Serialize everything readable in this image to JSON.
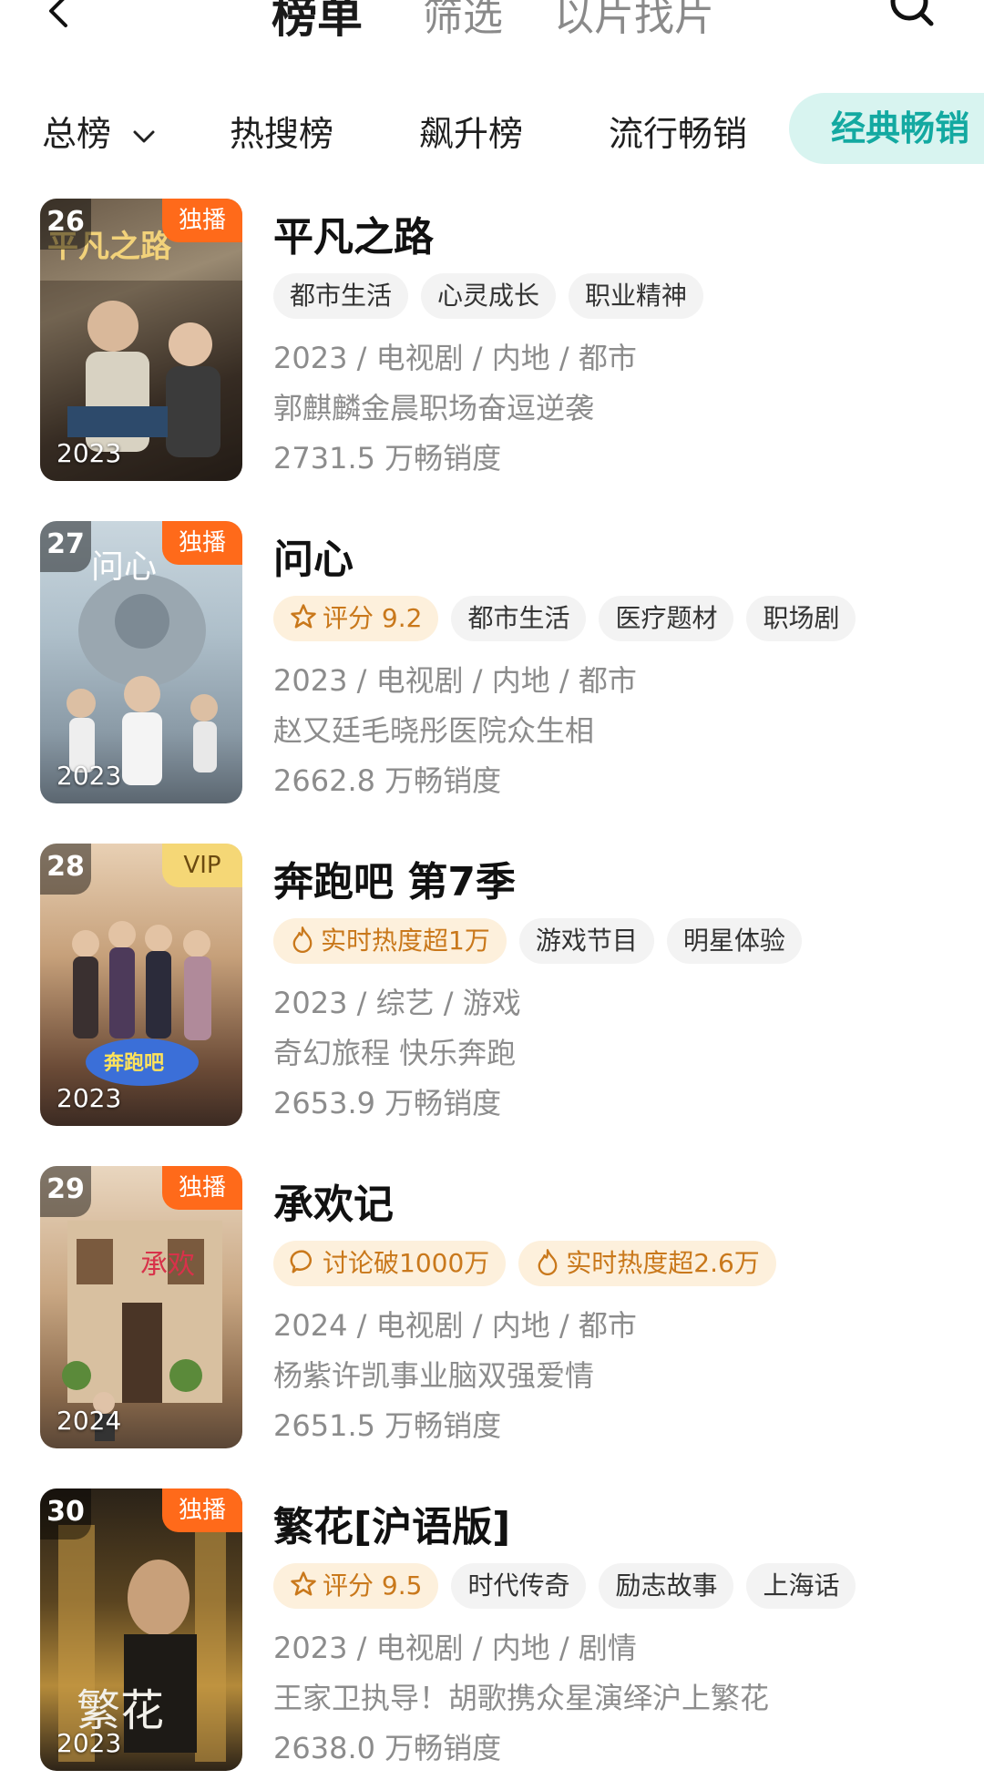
{
  "header": {
    "tabs": [
      "榜单",
      "筛选",
      "以片找片"
    ]
  },
  "categories": [
    {
      "label": "总榜"
    },
    {
      "label": "热搜榜"
    },
    {
      "label": "飙升榜"
    },
    {
      "label": "流行畅销"
    },
    {
      "label": "经典畅销"
    }
  ],
  "items": [
    {
      "rank": "26",
      "badge": "独播",
      "year": "2023",
      "title": "平凡之路",
      "tags": [
        {
          "text": "都市生活"
        },
        {
          "text": "心灵成长"
        },
        {
          "text": "职业精神"
        }
      ],
      "meta": "2023 / 电视剧 / 内地 / 都市",
      "desc": "郭麒麟金晨职场奋逗逆袭",
      "sales": "2731.5 万畅销度"
    },
    {
      "rank": "27",
      "badge": "独播",
      "year": "2023",
      "title": "问心",
      "tags": [
        {
          "text": "评分 9.2",
          "icon": "star-icon"
        },
        {
          "text": "都市生活"
        },
        {
          "text": "医疗题材"
        },
        {
          "text": "职场剧"
        }
      ],
      "meta": "2023 / 电视剧 / 内地 / 都市",
      "desc": "赵又廷毛晓彤医院众生相",
      "sales": "2662.8 万畅销度"
    },
    {
      "rank": "28",
      "badge": "VIP",
      "year": "2023",
      "title": "奔跑吧 第7季",
      "tags": [
        {
          "text": "实时热度超1万",
          "icon": "flame-icon"
        },
        {
          "text": "游戏节目"
        },
        {
          "text": "明星体验"
        }
      ],
      "meta": "2023 / 综艺 / 游戏",
      "desc": "奇幻旅程 快乐奔跑",
      "sales": "2653.9 万畅销度"
    },
    {
      "rank": "29",
      "badge": "独播",
      "year": "2024",
      "title": "承欢记",
      "tags": [
        {
          "text": "讨论破1000万",
          "icon": "chat-icon"
        },
        {
          "text": "实时热度超2.6万",
          "icon": "flame-icon"
        }
      ],
      "meta": "2024 / 电视剧 / 内地 / 都市",
      "desc": "杨紫许凯事业脑双强爱情",
      "sales": "2651.5 万畅销度"
    },
    {
      "rank": "30",
      "badge": "独播",
      "year": "2023",
      "title": "繁花[沪语版]",
      "tags": [
        {
          "text": "评分 9.5",
          "icon": "star-icon"
        },
        {
          "text": "时代传奇"
        },
        {
          "text": "励志故事"
        },
        {
          "text": "上海话"
        }
      ],
      "meta": "2023 / 电视剧 / 内地 / 剧情",
      "desc": "王家卫执导！胡歌携众星演绎沪上繁花",
      "sales": "2638.0 万畅销度"
    }
  ],
  "colors": {
    "accent": "#13a9a1",
    "exclusive_badge": "#ff6a1a",
    "vip_badge": "#f5d776",
    "hot_tag_text": "#c9781b"
  }
}
